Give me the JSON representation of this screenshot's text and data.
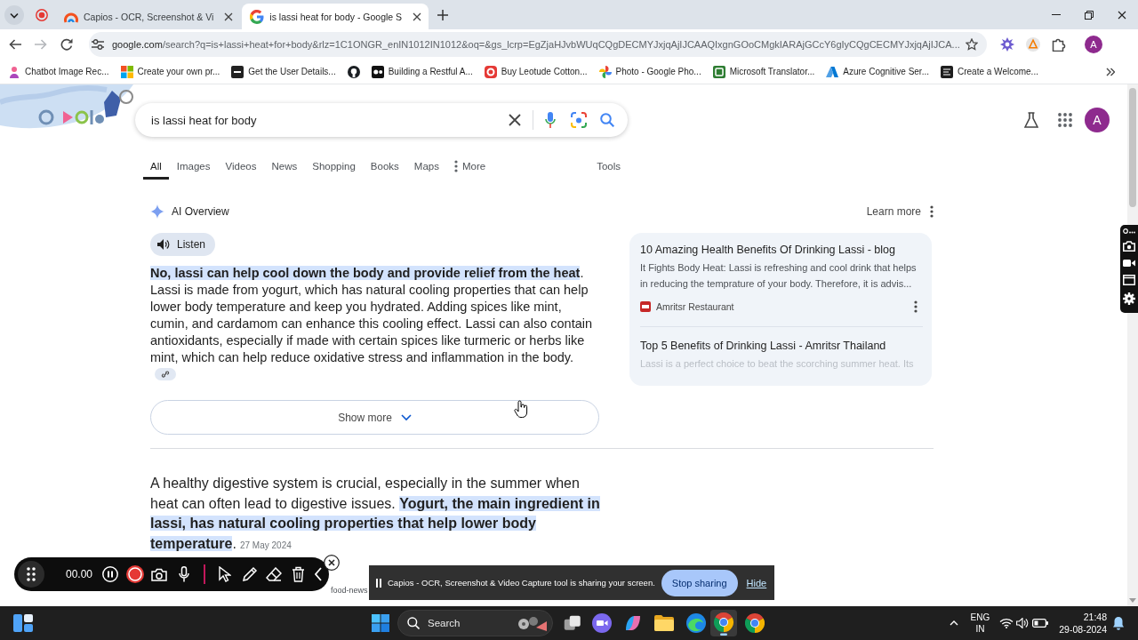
{
  "browser": {
    "tabs": [
      {
        "title": "Capios - OCR, Screenshot & Vi",
        "selected": false
      },
      {
        "title": "is lassi heat for body - Google S",
        "selected": true
      }
    ],
    "forward_disabled": true,
    "address_bar": {
      "host": "google.com",
      "path": "/search?q=is+lassi+heat+for+body&rlz=1C1ONGR_enIN1012IN1012&oq=&gs_lcrp=EgZjaHJvbWUqCQgDECMYJxjqAjIJCAAQIxgnGOoCMgkIARAjGCcY6gIyCQgCECMYJxjqAjIJCA..."
    },
    "profile_initial": "A",
    "bookmarks": [
      {
        "kind": "titled",
        "title": "Chatbot Image Rec..."
      },
      {
        "kind": "titled",
        "title": "Create your own pr..."
      },
      {
        "kind": "titled",
        "title": "Get the User Details..."
      },
      {
        "kind": "icon"
      },
      {
        "kind": "titled",
        "title": "Building a Restful A..."
      },
      {
        "kind": "titled",
        "title": "Buy Leotude Cotton..."
      },
      {
        "kind": "titled",
        "title": "Photo - Google Pho..."
      },
      {
        "kind": "titled",
        "title": "Microsoft Translator..."
      },
      {
        "kind": "titled",
        "title": "Azure Cognitive Ser..."
      },
      {
        "kind": "titled",
        "title": "Create a Welcome..."
      }
    ]
  },
  "search_page": {
    "query": "is lassi heat for body",
    "account_initial": "A",
    "nav_tabs": [
      {
        "kind": "tab",
        "label": "All",
        "selected": true
      },
      {
        "kind": "tab",
        "label": "Images",
        "selected": false
      },
      {
        "kind": "tab",
        "label": "Videos",
        "selected": false
      },
      {
        "kind": "tab",
        "label": "News",
        "selected": false
      },
      {
        "kind": "tab",
        "label": "Shopping",
        "selected": false
      },
      {
        "kind": "tab",
        "label": "Books",
        "selected": false
      },
      {
        "kind": "tab",
        "label": "Maps",
        "selected": false
      },
      {
        "kind": "menu",
        "label": "More",
        "selected": false
      }
    ],
    "tools": "Tools",
    "ai_overview": {
      "title": "AI Overview",
      "learn_more": "Learn more",
      "listen": "Listen",
      "summary": "**No, lassi can help cool down the body and provide relief from the heat**. Lassi is made from yogurt, which has natural cooling properties that can help lower body temperature and keep you hydrated. Adding spices like mint, cumin, and cardamom can enhance this cooling effect. Lassi can also contain antioxidants, especially if made with certain spices like turmeric or herbs like mint, which can help reduce oxidative stress and inflammation in the body.",
      "show_more": "Show more",
      "sources": [
        {
          "title": "10 Amazing Health Benefits Of Drinking Lassi - blog",
          "snippet": "It Fights Body Heat: Lassi is refreshing and cool drink that helps in reducing the temprature of your body. Therefore, it is advis...",
          "site": "Amritsr Restaurant",
          "faded": false
        },
        {
          "title": "Top 5 Benefits of Drinking Lassi - Amritsr Thailand",
          "snippet": "Lassi is a perfect choice to beat the scorching summer heat. Its",
          "faded": true
        }
      ]
    },
    "featured_snippet": {
      "text": "A healthy digestive system is crucial, especially in the summer when heat can often lead to digestive issues. **Yogurt, the main ingredient in lassi, has natural cooling properties that help lower body temperature**.",
      "date": "27 May 2024",
      "breadcrumb": "food-news"
    }
  },
  "recorder_toolbar": {
    "timer": "00.00"
  },
  "share_bar": {
    "message": "Capios - OCR, Screenshot & Video Capture tool is sharing your screen.",
    "stop_button": "Stop sharing",
    "hide_link": "Hide"
  },
  "taskbar": {
    "search": "Search",
    "apps": [
      {
        "selected": false
      },
      {
        "selected": false
      },
      {
        "selected": false
      },
      {
        "selected": false
      },
      {
        "selected": true
      },
      {
        "selected": false
      }
    ],
    "language": "ENG",
    "region": "IN",
    "time": "21:48",
    "date": "29-08-2024"
  }
}
